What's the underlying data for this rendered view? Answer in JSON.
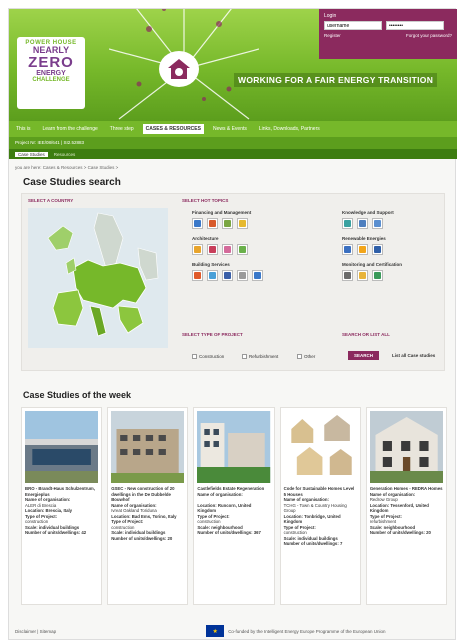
{
  "header": {
    "logo": {
      "line1": "POWER HOUSE",
      "line2": "NEARLY",
      "line3": "ZERO",
      "line4": "ENERGY",
      "line5": "CHALLENGE"
    },
    "tagline": "WORKING FOR A FAIR ENERGY TRANSITION",
    "login": {
      "label": "Login",
      "username": "username",
      "password": "••••••••",
      "register": "Register",
      "forgot": "Forgot your password?"
    }
  },
  "nav": {
    "items": [
      "This is",
      "Learn from the challenge",
      "Three step",
      "CASES & RESOURCES",
      "News & Events",
      "Links, Downloads, Partners"
    ],
    "active_index": 3
  },
  "subnav1": "Project Nr: IEE/08/641 | SI2.52883",
  "subnav2": {
    "items": [
      "Case Studies",
      "Resources"
    ],
    "active": "Case Studies"
  },
  "breadcrumb": "you are here: Cases & Resources > Case Studies >",
  "page_title": "Case Studies search",
  "search": {
    "country_title": "SELECT A COUNTRY",
    "hot_topics_title": "SELECT HOT TOPICS",
    "categories": [
      {
        "name": "Financing and Management"
      },
      {
        "name": "Knowledge and Support"
      },
      {
        "name": "Architecture"
      },
      {
        "name": "Renewable Energies"
      },
      {
        "name": "Building Services"
      },
      {
        "name": "Monitoring and Certification"
      }
    ],
    "project_type_title": "SELECT TYPE OF PROJECT",
    "project_types": [
      "Construction",
      "Refurbishment",
      "Other"
    ],
    "search_all_title": "SEARCH OR LIST ALL",
    "search_button": "SEARCH",
    "list_all": "List all Case studies"
  },
  "week_title": "Case Studies of the week",
  "cards": [
    {
      "title": "BRO - Brandt-Haus Schulzentrum, Energieplus",
      "org_label": "Name of organisation:",
      "org": "ALER di Brescia",
      "loc": "Location: Brescia, Italy",
      "type_label": "Type of Project:",
      "type": "construction",
      "scale": "Scale: individual buildings",
      "num_label": "Number of units/dwellings: 42"
    },
    {
      "title": "GSEC - New construction of 20 dwellings in the De Dubbelde Bouwhof",
      "org_label": "Name of organisation:",
      "org": "Ivreat Oakland Toriduna",
      "loc": "Location: Bad Ems, Torino, Italy",
      "type_label": "Type of Project:",
      "type": "construction",
      "scale": "Scale: individual buildings",
      "num_label": "Number of units/dwellings: 20"
    },
    {
      "title": "Castlefields Estate Regeneration",
      "org_label": "Name of organisation:",
      "org": "",
      "loc": "Location: Runcorn, United Kingdom",
      "type_label": "Type of Project:",
      "type": "construction",
      "scale": "Scale: neighbourhood",
      "num_label": "Number of units/dwellings: 367"
    },
    {
      "title": "Code for Sustainable Homes Level 5 Houses",
      "org_label": "Name of organisation:",
      "org": "TCHG - Town & Country Housing Group",
      "loc": "Location: Tonbridge, United Kingdom",
      "type_label": "Type of Project:",
      "type": "construction",
      "scale": "Scale: individual buildings",
      "num_label": "Number of units/dwellings: 7"
    },
    {
      "title": "Generation Homes - REDRA Homes",
      "org_label": "Name of organisation:",
      "org": "Redrow Group",
      "loc": "Location: Tessenford, United Kingdom",
      "type_label": "Type of Project:",
      "type": "refurbishment",
      "scale": "Scale: neighbourhood",
      "num_label": "Number of units/dwellings: 20"
    }
  ],
  "footer": {
    "links": "Disclaimer | Sitemap",
    "eu_text": "Co-funded by the Intelligent Energy Europe Programme of the European Union"
  },
  "colors": {
    "green": "#76b82a",
    "purple": "#8b2a5e",
    "dark_green": "#3d7d10"
  }
}
